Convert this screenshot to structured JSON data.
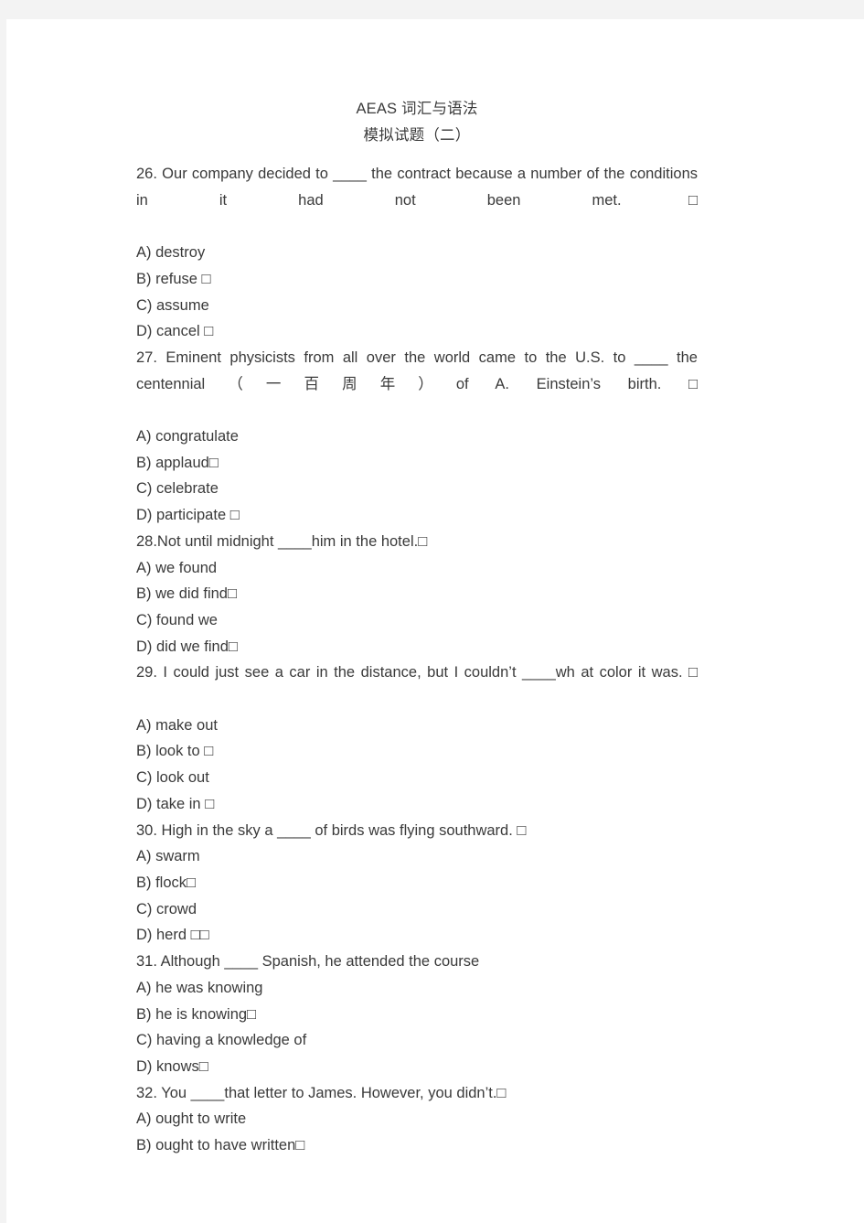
{
  "document": {
    "title_line_1": "AEAS 词汇与语法",
    "title_line_2": "模拟试题（二）",
    "page_background": "#ffffff",
    "margin_background": "#f3f3f3",
    "text_color": "#3a3a3a"
  },
  "questions": [
    {
      "number": "26.",
      "stem": "26. Our company decided to ____ the contract because a number of the conditions in it had not been met.□",
      "options": [
        {
          "label": "A)",
          "text": "A) destroy"
        },
        {
          "label": "B)",
          "text": "B) refuse □"
        },
        {
          "label": "C)",
          "text": "C) assume"
        },
        {
          "label": "D)",
          "text": "D) cancel □"
        }
      ]
    },
    {
      "number": "27.",
      "stem": "27. Eminent physicists from all over the world came to the U.S. to ____ the centennial（一百周年）of A. Einstein’s birth. □",
      "options": [
        {
          "label": "A)",
          "text": "A) congratulate"
        },
        {
          "label": "B)",
          "text": "B) applaud□"
        },
        {
          "label": "C)",
          "text": "C) celebrate"
        },
        {
          "label": "D)",
          "text": "D) participate □"
        }
      ]
    },
    {
      "number": "28.",
      "stem": "28.Not until midnight ____him in the hotel.□",
      "options": [
        {
          "label": "A)",
          "text": "A) we found"
        },
        {
          "label": "B)",
          "text": "B) we did find□"
        },
        {
          "label": "C)",
          "text": "C) found we"
        },
        {
          "label": "D)",
          "text": "D) did we find□"
        }
      ]
    },
    {
      "number": "29.",
      "stem": "29. I could just see a car in the distance, but I couldn’t ____wh at color it was. □",
      "options": [
        {
          "label": "A)",
          "text": "A) make out"
        },
        {
          "label": "B)",
          "text": "B) look to □"
        },
        {
          "label": "C)",
          "text": "C) look out"
        },
        {
          "label": "D)",
          "text": "D) take in □"
        }
      ]
    },
    {
      "number": "30.",
      "stem": "30. High in the sky a ____ of birds was flying southward. □",
      "options": [
        {
          "label": "A)",
          "text": "A) swarm"
        },
        {
          "label": "B)",
          "text": "B) flock□"
        },
        {
          "label": "C)",
          "text": "C) crowd"
        },
        {
          "label": "D)",
          "text": "D) herd □□"
        }
      ]
    },
    {
      "number": "31.",
      "stem": "31. Although ____ Spanish, he attended the course",
      "options": [
        {
          "label": "A)",
          "text": "A) he was knowing"
        },
        {
          "label": "B)",
          "text": "B) he is knowing□"
        },
        {
          "label": "C)",
          "text": "C) having a knowledge of"
        },
        {
          "label": "D)",
          "text": "D) knows□"
        }
      ]
    },
    {
      "number": "32.",
      "stem": "32. You ____that letter to James. However, you didn’t.□",
      "options": [
        {
          "label": "A)",
          "text": "A) ought to write"
        },
        {
          "label": "B)",
          "text": "B) ought to have written□"
        }
      ]
    }
  ]
}
